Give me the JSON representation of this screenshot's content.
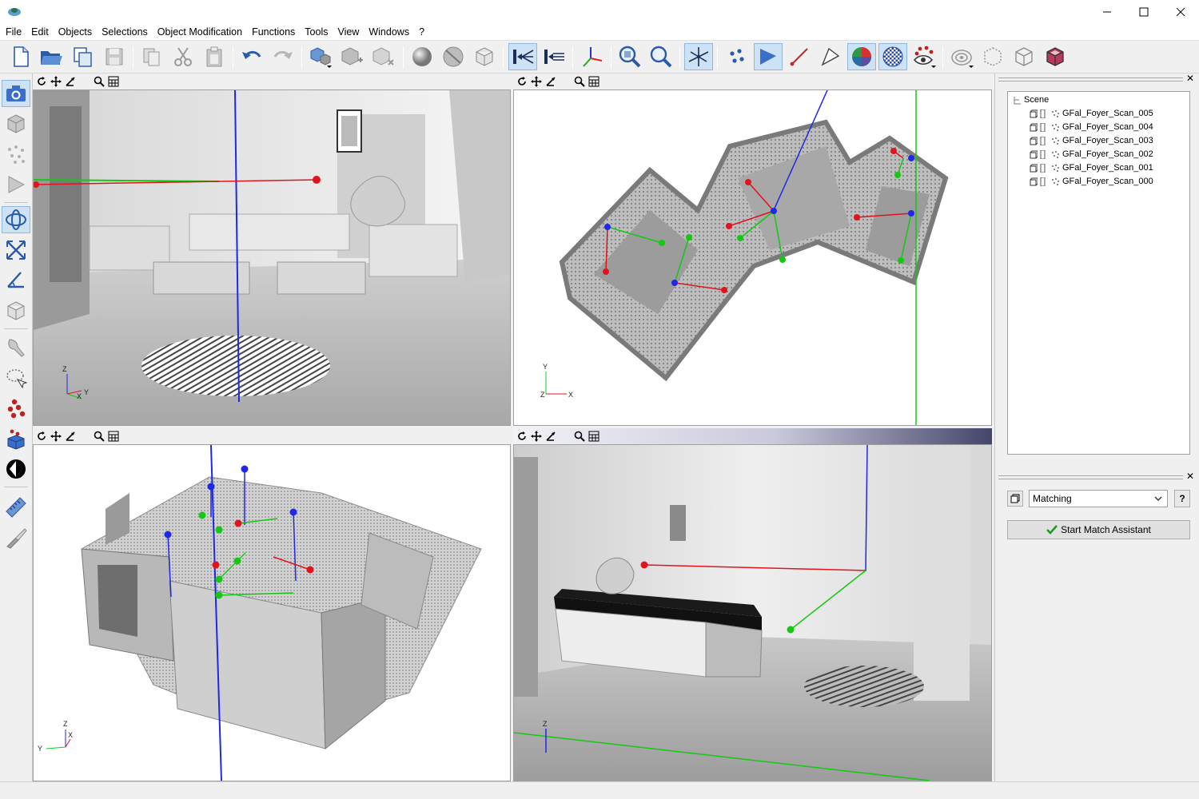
{
  "window": {
    "title": "",
    "buttons": [
      "minimize",
      "maximize",
      "close"
    ]
  },
  "menu": {
    "items": [
      "File",
      "Edit",
      "Objects",
      "Selections",
      "Object Modification",
      "Functions",
      "Tools",
      "View",
      "Windows",
      "?"
    ]
  },
  "toolbar": {
    "icons": [
      "new-file-icon",
      "open-folder-icon",
      "copy-window-icon",
      "save-icon",
      "copy-icon",
      "cut-icon",
      "paste-icon",
      "undo-icon",
      "redo-icon",
      "add-object-icon",
      "add-box-icon",
      "delete-object-icon",
      "shaded-sphere-icon",
      "flat-sphere-icon",
      "wireframe-cube-icon",
      "align-left-icon",
      "align-grid-icon",
      "axes-icon",
      "zoom-in-icon",
      "zoom-out-icon",
      "snap-axis-icon",
      "points-icon",
      "triangle-fill-icon",
      "line-icon",
      "triangle-outline-icon",
      "color-sphere-icon",
      "texture-sphere-icon",
      "eye-points-icon",
      "target-icon",
      "dotted-box-icon",
      "cube-outline-icon",
      "red-cube-icon"
    ]
  },
  "left_toolbar": {
    "icons": [
      "camera-icon",
      "box-icon",
      "point-cloud-icon",
      "triangle-icon",
      "rotate-icon",
      "scale-icon",
      "angle-icon",
      "cube-icon",
      "brush-icon",
      "lasso-icon",
      "red-points-icon",
      "scan-points-icon",
      "contrast-icon",
      "ruler-icon",
      "knife-icon"
    ]
  },
  "viewports": [
    {
      "id": "top-left",
      "axes": [
        "Z",
        "X",
        "Y"
      ]
    },
    {
      "id": "top-right",
      "axes": [
        "Y",
        "Z",
        "X"
      ]
    },
    {
      "id": "bottom-left",
      "axes": [
        "Z",
        "X",
        "Y"
      ]
    },
    {
      "id": "bottom-right",
      "axes": [
        "Z"
      ]
    }
  ],
  "scene_tree": {
    "root": "Scene",
    "items": [
      "GFal_Foyer_Scan_005",
      "GFal_Foyer_Scan_004",
      "GFal_Foyer_Scan_003",
      "GFal_Foyer_Scan_002",
      "GFal_Foyer_Scan_001",
      "GFal_Foyer_Scan_000"
    ]
  },
  "matching_panel": {
    "mode_selected": "Matching",
    "help_label": "?",
    "start_button_label": "Start Match Assistant"
  },
  "colors": {
    "x_axis": "#e0141e",
    "y_axis": "#14c814",
    "z_axis": "#1e28e6",
    "active_viewport": "#45456a"
  }
}
